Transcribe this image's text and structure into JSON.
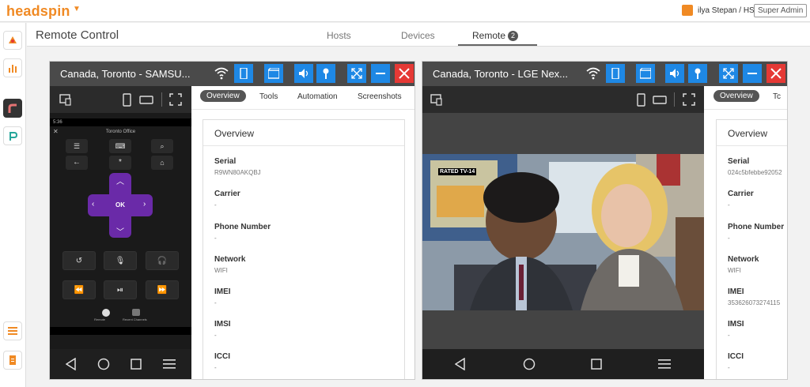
{
  "topbar": {
    "brand": "headspin",
    "user": "ilya Stepan / HS",
    "role": "Super Admin"
  },
  "page": {
    "title": "Remote Control",
    "tabs": [
      {
        "label": "Hosts"
      },
      {
        "label": "Devices"
      },
      {
        "label": "Remote",
        "count": "2"
      }
    ]
  },
  "rail": {
    "icons": [
      "shapes-icon",
      "bar-chart-icon",
      "app-r-icon",
      "app-p-icon",
      "list-icon",
      "document-icon"
    ]
  },
  "panels": [
    {
      "title": "Canada, Toronto - SAMSU...",
      "tabs": [
        "Overview",
        "Tools",
        "Automation",
        "Screenshots"
      ],
      "overview_title": "Overview",
      "fields": [
        {
          "label": "Serial",
          "value": "R9WN80AKQBJ"
        },
        {
          "label": "Carrier",
          "value": "-"
        },
        {
          "label": "Phone Number",
          "value": "-"
        },
        {
          "label": "Network",
          "value": "WIFI"
        },
        {
          "label": "IMEI",
          "value": "-"
        },
        {
          "label": "IMSI",
          "value": "-"
        },
        {
          "label": "ICCI",
          "value": "-"
        }
      ],
      "phone": {
        "status_time": "5:36",
        "remote_title": "Toronto Office",
        "ok_label": "OK",
        "bottom_labels": [
          "Remote",
          "Recent Channels"
        ]
      }
    },
    {
      "title": "Canada, Toronto - LGE Nex...",
      "tabs": [
        "Overview",
        "Tc"
      ],
      "overview_title": "Overview",
      "fields": [
        {
          "label": "Serial",
          "value": "024c5bfebbe92052"
        },
        {
          "label": "Carrier",
          "value": "-"
        },
        {
          "label": "Phone Number",
          "value": "-"
        },
        {
          "label": "Network",
          "value": "WIFI"
        },
        {
          "label": "IMEI",
          "value": "353626073274115"
        },
        {
          "label": "IMSI",
          "value": "-"
        },
        {
          "label": "ICCI",
          "value": "-"
        }
      ],
      "video_overlay": "RATED TV-14"
    }
  ],
  "colors": {
    "brand": "#f08a24",
    "header_button": "#1e88e5",
    "close_button": "#e53935",
    "dpad": "#6a2aa8"
  }
}
